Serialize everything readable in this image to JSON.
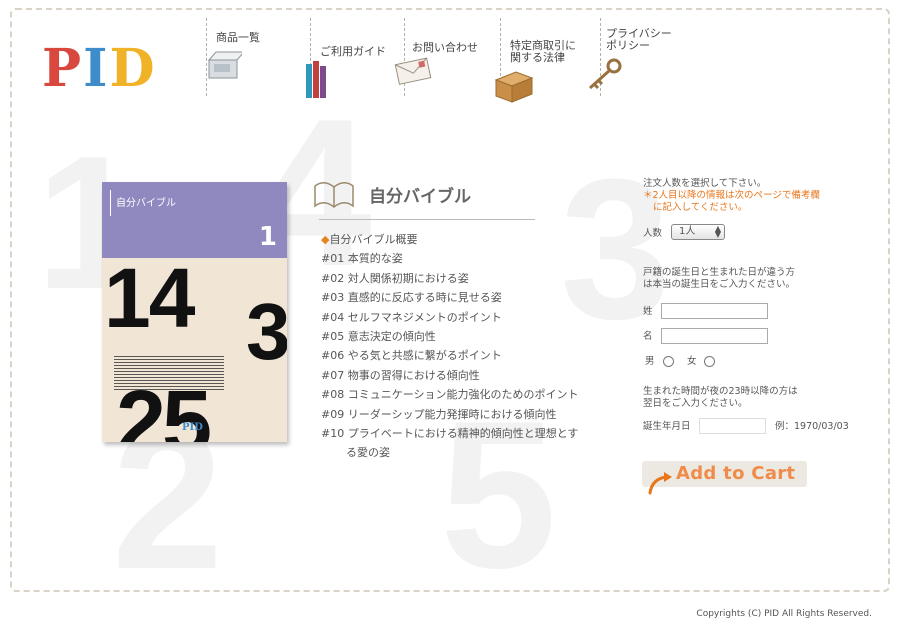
{
  "brand": {
    "logo_text_p": "P",
    "logo_text_i": "I",
    "logo_text_d": "D"
  },
  "nav": [
    {
      "label": "商品一覧",
      "icon": "shopping-box-icon"
    },
    {
      "label": "ご利用ガイド",
      "icon": "books-icon"
    },
    {
      "label": "お問い合わせ",
      "icon": "envelope-icon"
    },
    {
      "label_line1": "特定商取引に",
      "label_line2": "関する法律",
      "icon": "cardboard-box-icon"
    },
    {
      "label_line1": "プライバシー",
      "label_line2": "ポリシー",
      "icon": "key-icon"
    }
  ],
  "background_numbers": [
    "1",
    "4",
    "3",
    "2",
    "5"
  ],
  "cover": {
    "title": "自分バイブル",
    "volume": "1",
    "numbers": [
      "14",
      "3",
      "25"
    ],
    "mini_logo": "PID"
  },
  "product": {
    "title": "自分バイブル",
    "toc": [
      {
        "num": "◆",
        "text": "自分バイブル概要"
      },
      {
        "num": "#01",
        "text": "本質的な姿"
      },
      {
        "num": "#02",
        "text": "対人関係初期における姿"
      },
      {
        "num": "#03",
        "text": "直感的に反応する時に見せる姿"
      },
      {
        "num": "#04",
        "text": "セルフマネジメントのポイント"
      },
      {
        "num": "#05",
        "text": "意志決定の傾向性"
      },
      {
        "num": "#06",
        "text": "やる気と共感に繋がるポイント"
      },
      {
        "num": "#07",
        "text": "物事の習得における傾向性"
      },
      {
        "num": "#08",
        "text": "コミュニケーション能力強化のためのポイント"
      },
      {
        "num": "#09",
        "text": "リーダーシップ能力発揮時における傾向性"
      },
      {
        "num": "#10",
        "text": "プライベートにおける精神的傾向性と理想とする愛の姿"
      }
    ]
  },
  "order_form": {
    "count_prompt": "注文人数を選択して下さい。",
    "count_note_line1": "＊2人目以降の情報は次のページで備考欄",
    "count_note_line2": "に記入してください。",
    "count_label": "人数",
    "count_value": "1人",
    "birth_note_line1": "戸籍の誕生日と生まれた日が違う方",
    "birth_note_line2": "は本当の誕生日をご入力ください。",
    "last_name_label": "姓",
    "first_name_label": "名",
    "male_label": "男",
    "female_label": "女",
    "time_note_line1": "生まれた時間が夜の23時以降の方は",
    "time_note_line2": "翌日をご入力ください。",
    "birthday_label": "誕生年月日",
    "birthday_example": "例：1970/03/03",
    "accent_color": "#e8761b",
    "cart_label": "Add to Cart"
  },
  "footer": {
    "copyright": "Copyrights (C) PID All Rights Reserved."
  }
}
